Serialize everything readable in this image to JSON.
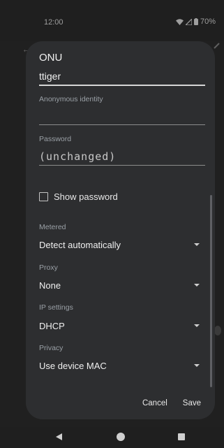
{
  "status_bar": {
    "time": "12:00",
    "battery": "70%",
    "icons": [
      "wifi-icon",
      "signal-icon",
      "battery-icon"
    ]
  },
  "dialog": {
    "network_title": "ONU",
    "identity_value": "ttiger",
    "anonymous_identity_label": "Anonymous identity",
    "anonymous_identity_value": "",
    "password_label": "Password",
    "password_value": "(unchanged)",
    "show_password_label": "Show password",
    "show_password_checked": false,
    "metered_label": "Metered",
    "metered_value": "Detect automatically",
    "proxy_label": "Proxy",
    "proxy_value": "None",
    "ip_settings_label": "IP settings",
    "ip_settings_value": "DHCP",
    "privacy_label": "Privacy",
    "privacy_value": "Use device MAC",
    "cancel_label": "Cancel",
    "save_label": "Save"
  },
  "colors": {
    "dialog_bg": "#2d2e30",
    "text_primary": "#f0f0f0",
    "text_secondary": "#9aa0a6"
  }
}
